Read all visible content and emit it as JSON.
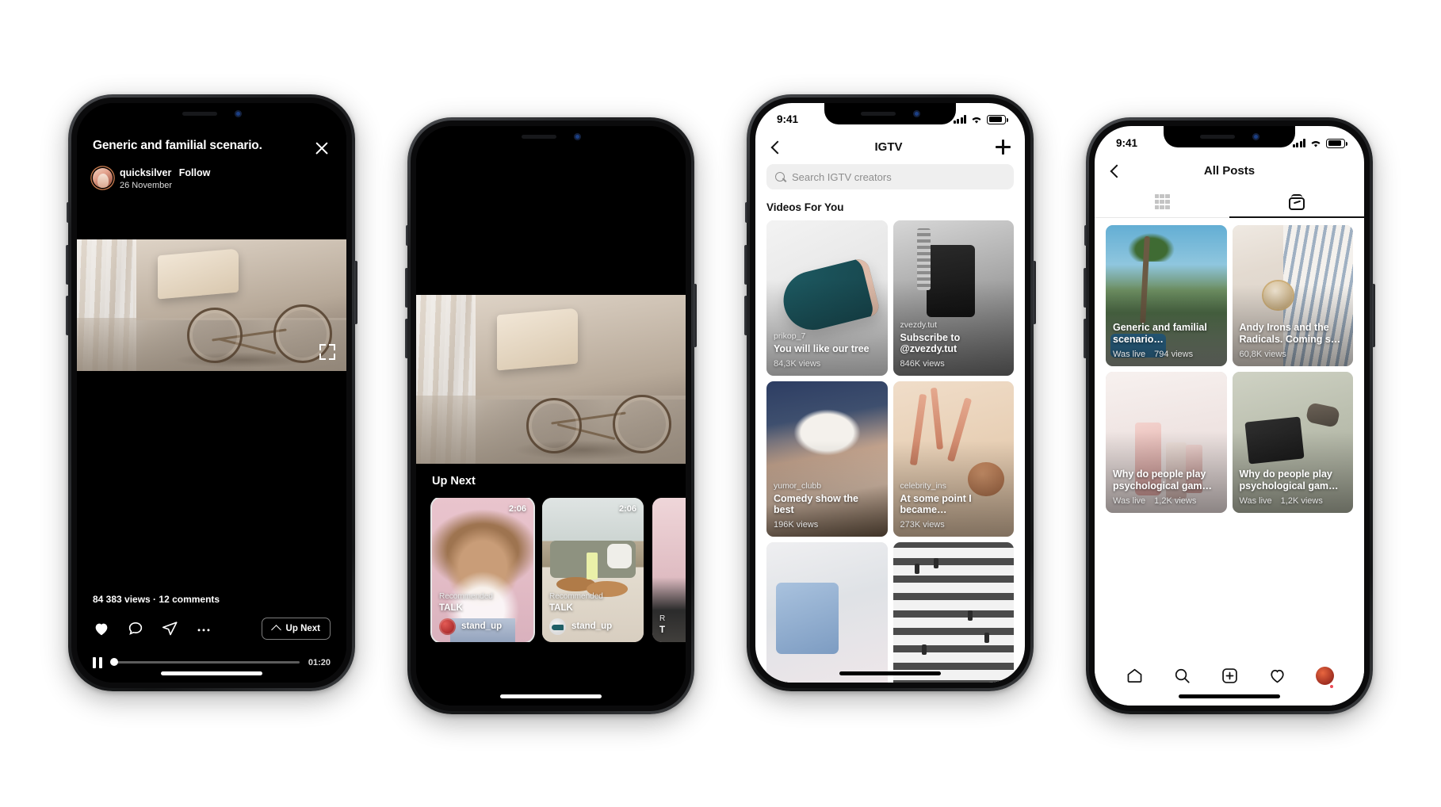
{
  "phone1": {
    "title": "Generic and familial scenario.",
    "username": "quicksilver",
    "follow_label": "Follow",
    "date": "26 November",
    "close_icon": "close-icon",
    "fullscreen_icon": "fullscreen-expand-icon",
    "stats": "84 383 views  ·  12 comments",
    "icons": [
      "heart-icon",
      "comment-icon",
      "share-icon",
      "more-options-icon"
    ],
    "up_next_label": "Up Next",
    "time": "01:20",
    "progress_percent": 2
  },
  "phone2": {
    "up_next_title": "Up Next",
    "cards": [
      {
        "duration": "2:06",
        "recommended": "Recommended",
        "category": "TALK",
        "user": "stand_up"
      },
      {
        "duration": "2:06",
        "recommended": "Recommended",
        "category": "TALK",
        "user": "stand_up"
      },
      {
        "duration": "",
        "recommended": "R",
        "category": "T",
        "user": ""
      }
    ]
  },
  "phone3": {
    "status": {
      "time": "9:41"
    },
    "nav": {
      "back_icon": "chevron-left-icon",
      "title": "IGTV",
      "add_icon": "plus-icon"
    },
    "search": {
      "icon": "search-icon",
      "placeholder": "Search IGTV creators"
    },
    "section_title": "Videos For You",
    "videos": [
      {
        "user": "prikop_7",
        "title": "You will like our tree",
        "views": "84,3K views"
      },
      {
        "user": "zvezdy.tut",
        "title": "Subscribe to @zvezdy.tut",
        "views": "846K views"
      },
      {
        "user": "yumor_clubb",
        "title": "Comedy show the best",
        "views": "196K views"
      },
      {
        "user": "celebrity_ins",
        "title": "At some point I became…",
        "views": "273K views"
      },
      {
        "user": "",
        "title": "",
        "views": ""
      },
      {
        "user": "",
        "title": "",
        "views": ""
      }
    ]
  },
  "phone4": {
    "status": {
      "time": "9:41"
    },
    "nav": {
      "back_icon": "chevron-left-icon",
      "title": "All Posts"
    },
    "tabs": [
      {
        "icon": "grid-icon",
        "active": false
      },
      {
        "icon": "igtv-icon",
        "active": true
      }
    ],
    "posts": [
      {
        "title": "Generic and familial scenario…",
        "live": "Was live",
        "views": "794 views"
      },
      {
        "title": "Andy Irons and the Radicals. Coming s…",
        "live": "",
        "views": "60,8K views"
      },
      {
        "title": "Why do people play psychological gam…",
        "live": "Was live",
        "views": "1,2K views"
      },
      {
        "title": "Why do people play psychological gam…",
        "live": "Was live",
        "views": "1,2K views"
      }
    ],
    "bottom_nav": [
      "home-icon",
      "search-icon",
      "new-post-icon",
      "activity-heart-icon",
      "profile-avatar"
    ]
  }
}
